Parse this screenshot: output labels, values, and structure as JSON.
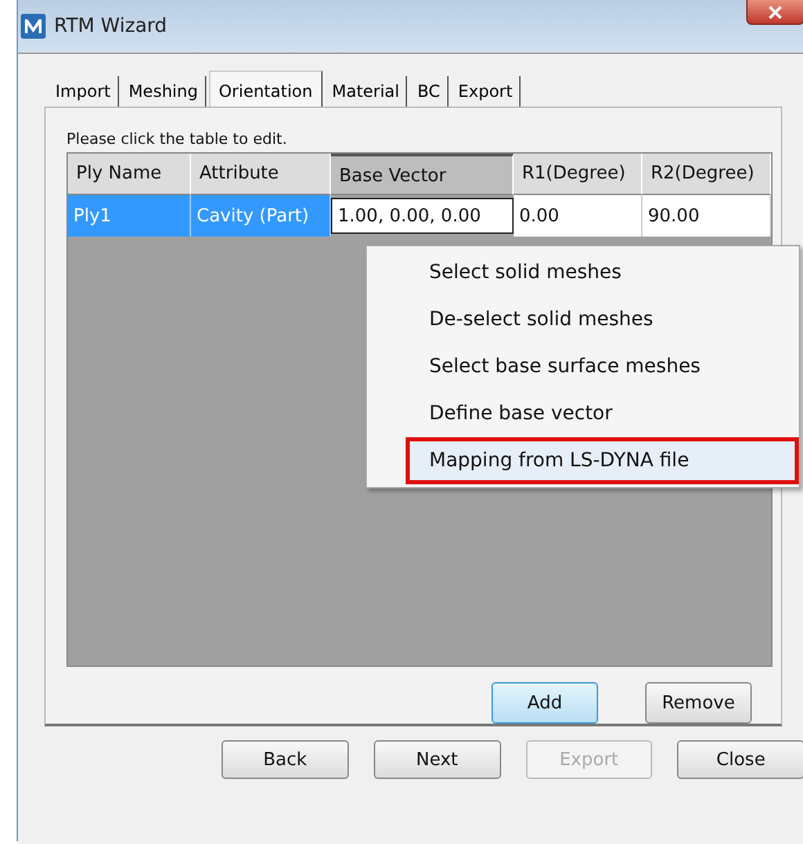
{
  "window": {
    "title": "RTM Wizard"
  },
  "tabs": [
    {
      "label": "Import",
      "selected": false
    },
    {
      "label": "Meshing",
      "selected": false
    },
    {
      "label": "Orientation",
      "selected": true
    },
    {
      "label": "Material",
      "selected": false
    },
    {
      "label": "BC",
      "selected": false
    },
    {
      "label": "Export",
      "selected": false
    }
  ],
  "instruction": "Please click the table to edit.",
  "table": {
    "columns": [
      {
        "label": "Ply Name",
        "selected": false
      },
      {
        "label": "Attribute",
        "selected": false
      },
      {
        "label": "Base Vector",
        "selected": true
      },
      {
        "label": "R1(Degree)",
        "selected": false
      },
      {
        "label": "R2(Degree)",
        "selected": false
      }
    ],
    "rows": [
      {
        "selected": true,
        "cells": [
          {
            "text": "Ply1",
            "editing": false
          },
          {
            "text": "Cavity (Part)",
            "editing": false
          },
          {
            "text": "1.00, 0.00, 0.00",
            "editing": true
          },
          {
            "text": "0.00",
            "editing": false
          },
          {
            "text": "90.00",
            "editing": false
          }
        ]
      }
    ]
  },
  "context_menu": [
    {
      "label": "Select solid meshes",
      "selected": false,
      "annotated": false
    },
    {
      "label": "De-select solid meshes",
      "selected": false,
      "annotated": false
    },
    {
      "label": "Select base surface meshes",
      "selected": false,
      "annotated": false
    },
    {
      "label": "Define base vector",
      "selected": false,
      "annotated": false
    },
    {
      "label": "Mapping from LS-DYNA file",
      "selected": true,
      "annotated": true
    }
  ],
  "panel_buttons": [
    {
      "label": "Add",
      "focused": true
    },
    {
      "label": "Remove",
      "focused": false
    }
  ],
  "footer_buttons": [
    {
      "label": "Back",
      "disabled": false
    },
    {
      "label": "Next",
      "disabled": false
    },
    {
      "label": "Export",
      "disabled": true
    },
    {
      "label": "Close",
      "disabled": false
    }
  ]
}
